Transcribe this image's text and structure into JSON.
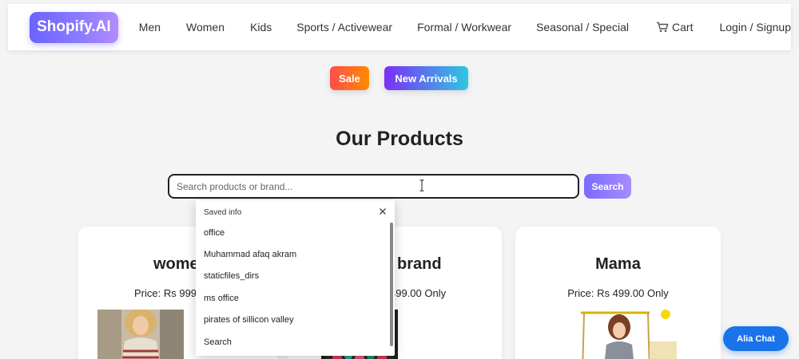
{
  "brand": {
    "logo_text": "Shopify.AI",
    "accent": "#6c63ff"
  },
  "nav": {
    "men": "Men",
    "women": "Women",
    "kids": "Kids",
    "sports": "Sports / Activewear",
    "formal": "Formal / Workwear",
    "seasonal": "Seasonal / Special",
    "cart": "Cart",
    "login": "Login / Signup"
  },
  "promo": {
    "sale": "Sale",
    "new_arrivals": "New Arrivals"
  },
  "section_title": "Our Products",
  "search": {
    "placeholder": "Search products or brand...",
    "value": "",
    "button": "Search"
  },
  "autofill": {
    "header": "Saved info",
    "items": [
      "office",
      "Muhammad afaq akram",
      "staticfiles_dirs",
      "ms office",
      "pirates of sillicon valley",
      "Search"
    ]
  },
  "products": [
    {
      "title": "wome",
      "price": "Price: Rs 999.0"
    },
    {
      "title": "brand",
      "price": "499.00 Only"
    },
    {
      "title": "Mama",
      "price": "Price: Rs 499.00 Only"
    }
  ],
  "chat": {
    "label": "Alia Chat",
    "color": "#1a73e8"
  }
}
